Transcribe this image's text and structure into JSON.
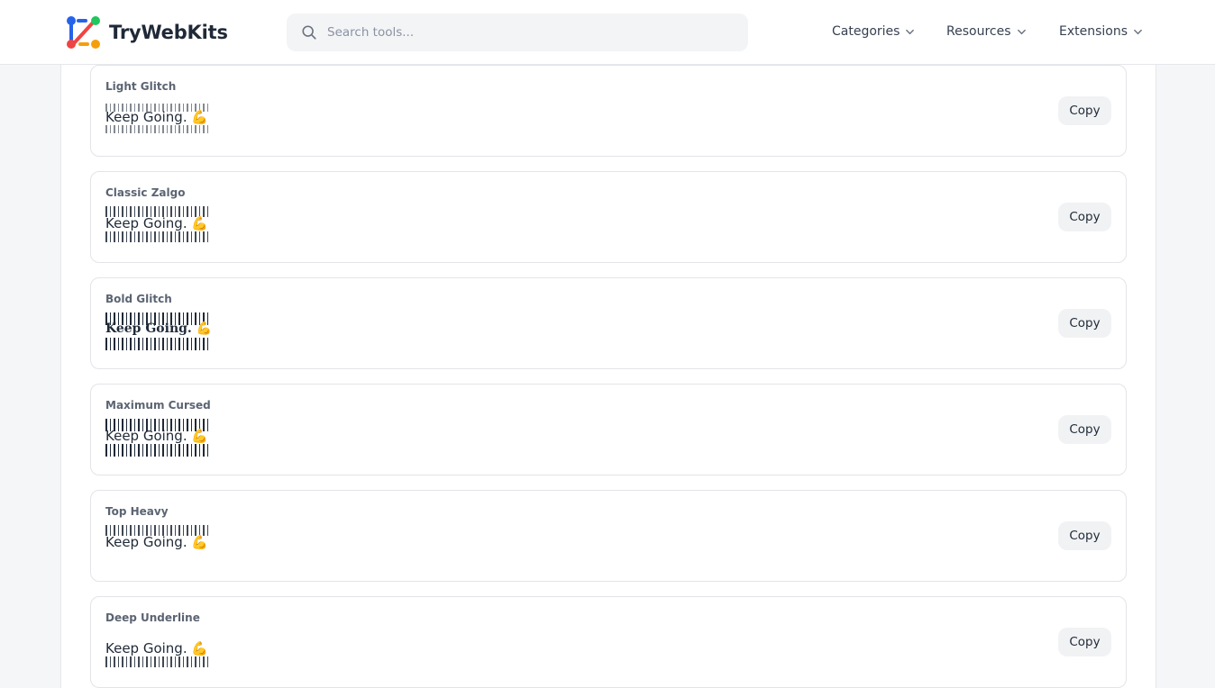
{
  "header": {
    "brand": "TryWebKits",
    "search_placeholder": "Search tools...",
    "nav": [
      {
        "label": "Categories"
      },
      {
        "label": "Resources"
      },
      {
        "label": "Extensions"
      }
    ]
  },
  "colors": {
    "logo_blue": "#2563eb",
    "logo_red": "#ef4444",
    "logo_green": "#22c55e",
    "logo_yellow": "#f59e0b"
  },
  "styles": [
    {
      "name": "Light Glitch",
      "text": "Keep Going. 💪",
      "copy_label": "Copy"
    },
    {
      "name": "Classic Zalgo",
      "text": "Keep Going. 💪",
      "copy_label": "Copy"
    },
    {
      "name": "Bold Glitch",
      "text": "Keep Going. 💪",
      "copy_label": "Copy"
    },
    {
      "name": "Maximum Cursed",
      "text": "Keep Going. 💪",
      "copy_label": "Copy"
    },
    {
      "name": "Top Heavy",
      "text": "Keep Going. 💪",
      "copy_label": "Copy"
    },
    {
      "name": "Deep Underline",
      "text": "Keep Going. 💪",
      "copy_label": "Copy"
    }
  ]
}
